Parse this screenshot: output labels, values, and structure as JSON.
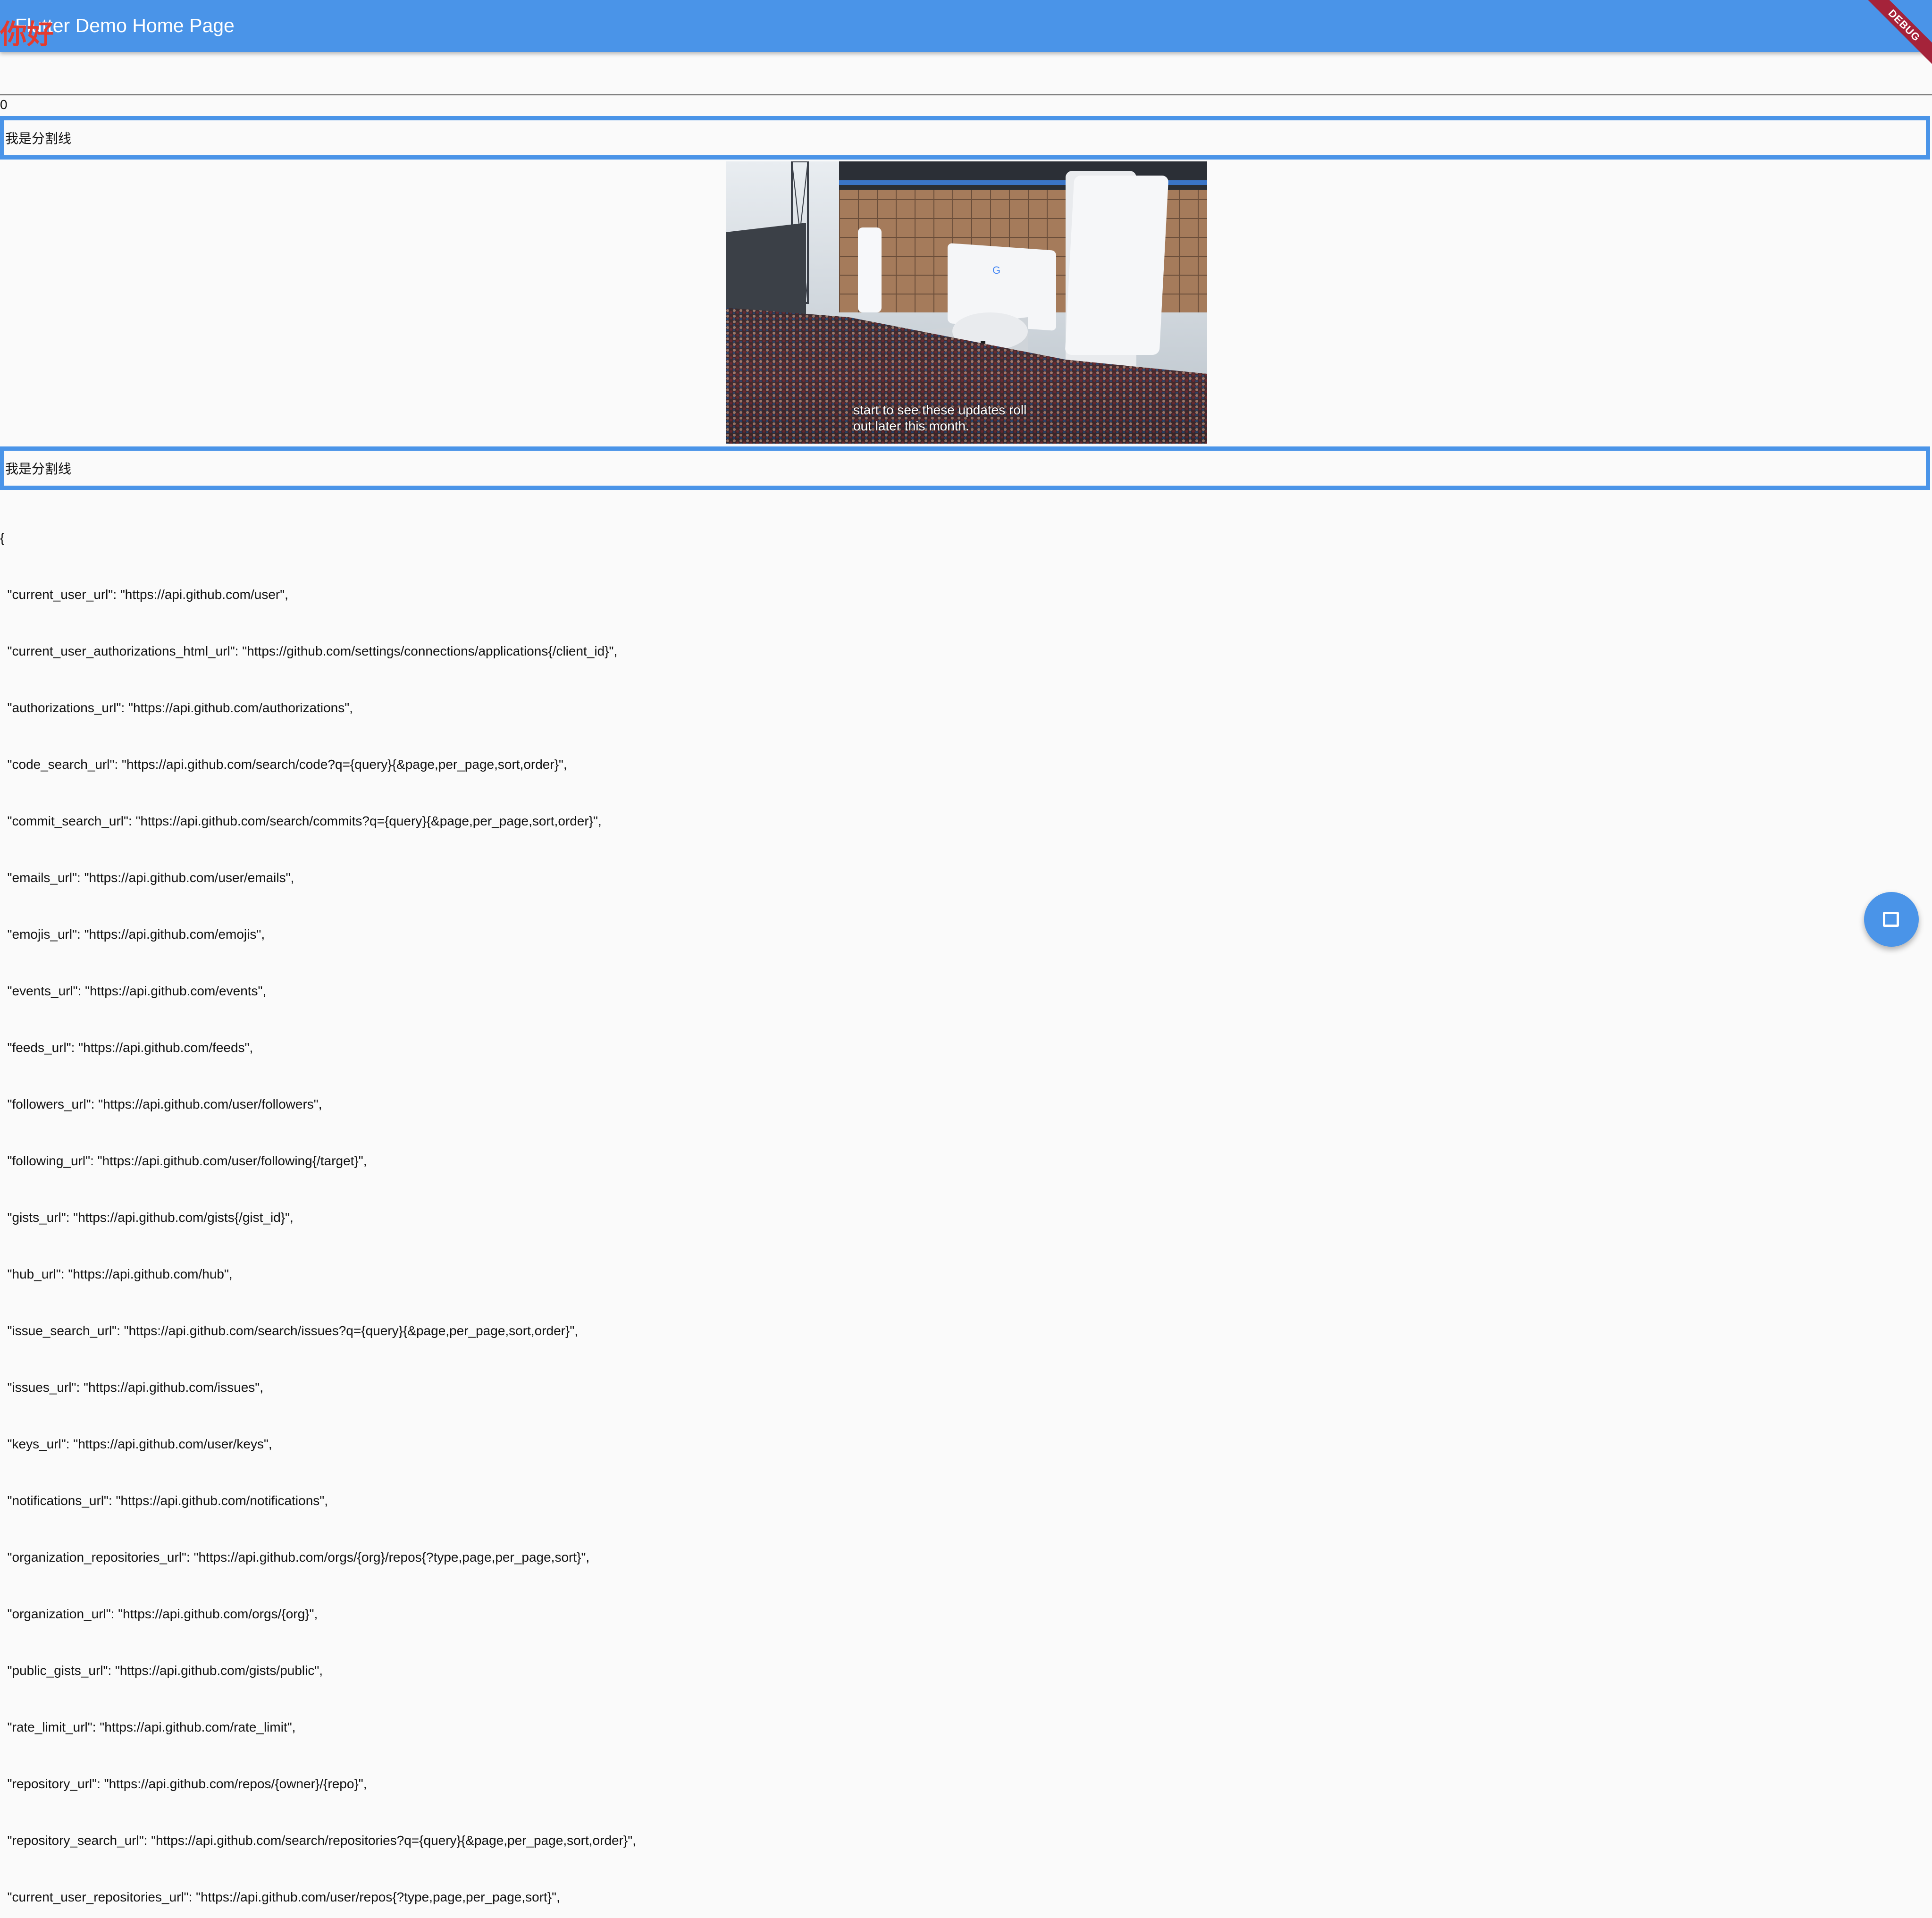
{
  "app_bar": {
    "title": "Flutter Demo Home Page",
    "overlay_text": "你好",
    "debug_label": "DEBUG"
  },
  "counter": {
    "value": "0"
  },
  "dividers": {
    "label": "我是分割线"
  },
  "video": {
    "caption_line1": "start to see these updates roll",
    "caption_line2": "out later this month."
  },
  "json_lines": [
    "{",
    "  \"current_user_url\": \"https://api.github.com/user\",",
    "  \"current_user_authorizations_html_url\": \"https://github.com/settings/connections/applications{/client_id}\",",
    "  \"authorizations_url\": \"https://api.github.com/authorizations\",",
    "  \"code_search_url\": \"https://api.github.com/search/code?q={query}{&page,per_page,sort,order}\",",
    "  \"commit_search_url\": \"https://api.github.com/search/commits?q={query}{&page,per_page,sort,order}\",",
    "  \"emails_url\": \"https://api.github.com/user/emails\",",
    "  \"emojis_url\": \"https://api.github.com/emojis\",",
    "  \"events_url\": \"https://api.github.com/events\",",
    "  \"feeds_url\": \"https://api.github.com/feeds\",",
    "  \"followers_url\": \"https://api.github.com/user/followers\",",
    "  \"following_url\": \"https://api.github.com/user/following{/target}\",",
    "  \"gists_url\": \"https://api.github.com/gists{/gist_id}\",",
    "  \"hub_url\": \"https://api.github.com/hub\",",
    "  \"issue_search_url\": \"https://api.github.com/search/issues?q={query}{&page,per_page,sort,order}\",",
    "  \"issues_url\": \"https://api.github.com/issues\",",
    "  \"keys_url\": \"https://api.github.com/user/keys\",",
    "  \"notifications_url\": \"https://api.github.com/notifications\",",
    "  \"organization_repositories_url\": \"https://api.github.com/orgs/{org}/repos{?type,page,per_page,sort}\",",
    "  \"organization_url\": \"https://api.github.com/orgs/{org}\",",
    "  \"public_gists_url\": \"https://api.github.com/gists/public\",",
    "  \"rate_limit_url\": \"https://api.github.com/rate_limit\",",
    "  \"repository_url\": \"https://api.github.com/repos/{owner}/{repo}\",",
    "  \"repository_search_url\": \"https://api.github.com/search/repositories?q={query}{&page,per_page,sort,order}\",",
    "  \"current_user_repositories_url\": \"https://api.github.com/user/repos{?type,page,per_page,sort}\","
  ],
  "fab": {
    "icon": "square-outline-icon"
  },
  "colors": {
    "primary": "#4a94e8",
    "overlay_text": "#e33b2f",
    "debug_banner": "#a5233a",
    "background": "#fafafa"
  }
}
